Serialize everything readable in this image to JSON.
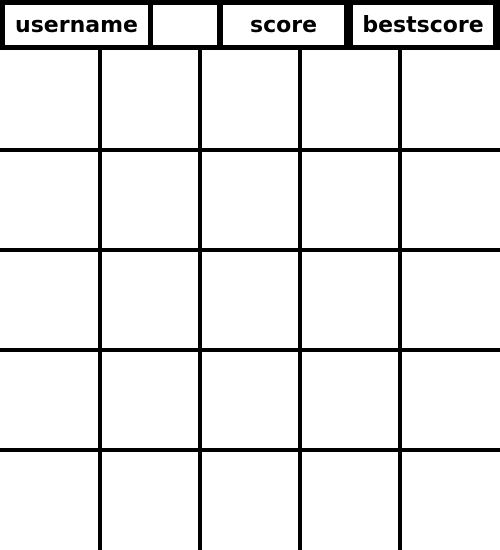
{
  "header": {
    "username_label": "username",
    "blank_label": "",
    "score_label": "score",
    "bestscore_label": "bestscore"
  },
  "board": {
    "rows": 5,
    "cols": 5,
    "cells": [
      [
        "",
        "",
        "",
        "",
        ""
      ],
      [
        "",
        "",
        "",
        "",
        ""
      ],
      [
        "",
        "",
        "",
        "",
        ""
      ],
      [
        "",
        "",
        "",
        "",
        ""
      ],
      [
        "",
        "",
        "",
        "",
        ""
      ]
    ]
  },
  "colors": {
    "line": "#000000",
    "background": "#ffffff"
  }
}
